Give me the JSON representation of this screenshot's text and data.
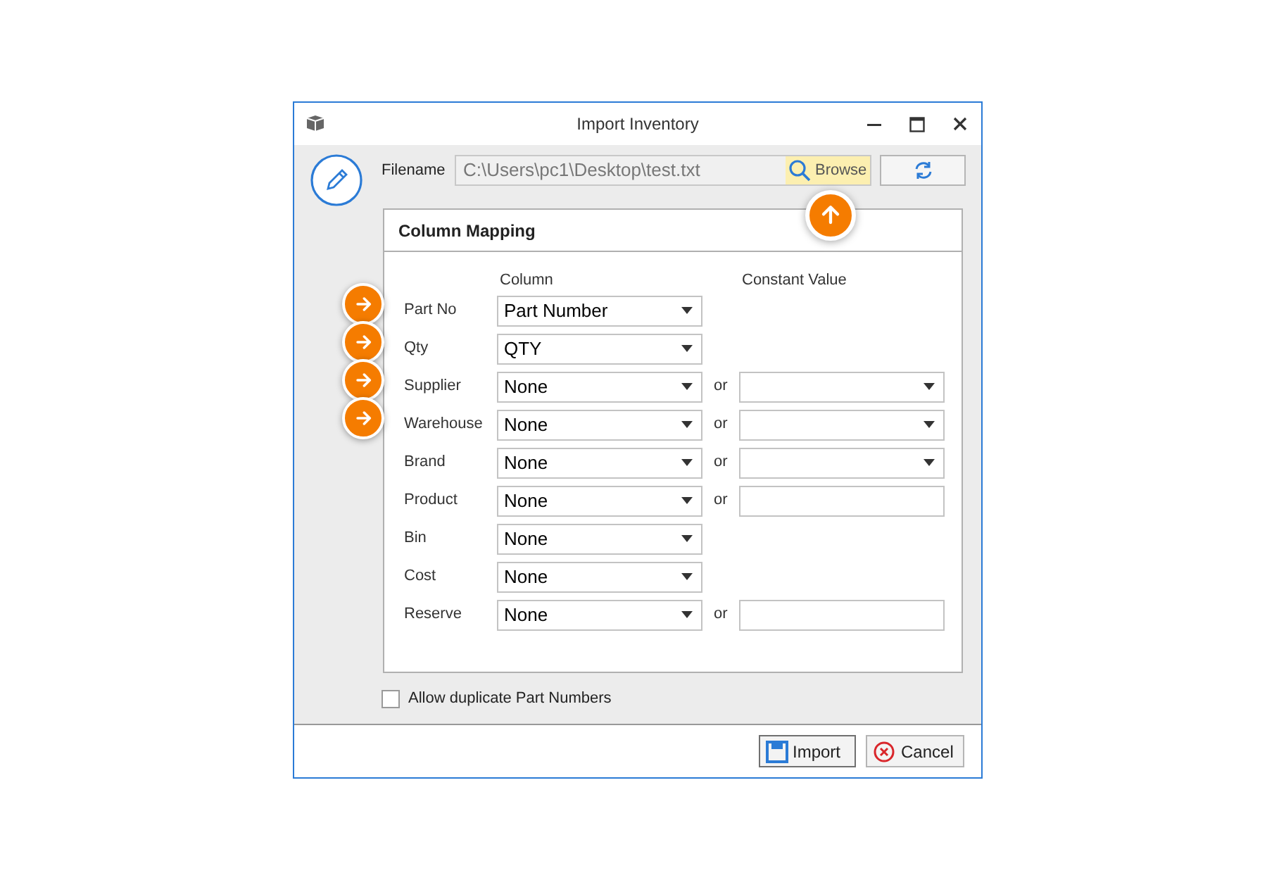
{
  "window": {
    "title": "Import Inventory"
  },
  "filename": {
    "label": "Filename",
    "value": "C:\\Users\\pc1\\Desktop\\test.txt",
    "browse_label": "Browse",
    "browse_hovered": true,
    "browse_callout": true
  },
  "column_mapping": {
    "title": "Column Mapping",
    "column_heading": "Column",
    "constant_heading": "Constant Value",
    "rows": [
      {
        "label": "Part No",
        "column": "Part Number",
        "kind": "column_only",
        "callout": true
      },
      {
        "label": "Qty",
        "column": "QTY",
        "kind": "column_only",
        "callout": true
      },
      {
        "label": "Supplier",
        "column": "None",
        "or_label": "or",
        "kind": "dropdown",
        "callout": true
      },
      {
        "label": "Warehouse",
        "column": "None",
        "or_label": "or",
        "kind": "dropdown",
        "callout": true
      },
      {
        "label": "Brand",
        "column": "None",
        "or_label": "or",
        "kind": "dropdown",
        "callout": false
      },
      {
        "label": "Product",
        "column": "None",
        "or_label": "or",
        "kind": "text",
        "callout": false
      },
      {
        "label": "Bin",
        "column": "None",
        "kind": "column_only",
        "callout": false
      },
      {
        "label": "Cost",
        "column": "None",
        "kind": "column_only",
        "callout": false
      },
      {
        "label": "Reserve",
        "column": "None",
        "or_label": "or",
        "kind": "text",
        "callout": false
      }
    ]
  },
  "allow_duplicates": {
    "label": "Allow duplicate Part Numbers",
    "checked": false
  },
  "buttons": [
    {
      "kind": "import",
      "label": "Import"
    },
    {
      "kind": "cancel",
      "label": "Cancel"
    }
  ]
}
